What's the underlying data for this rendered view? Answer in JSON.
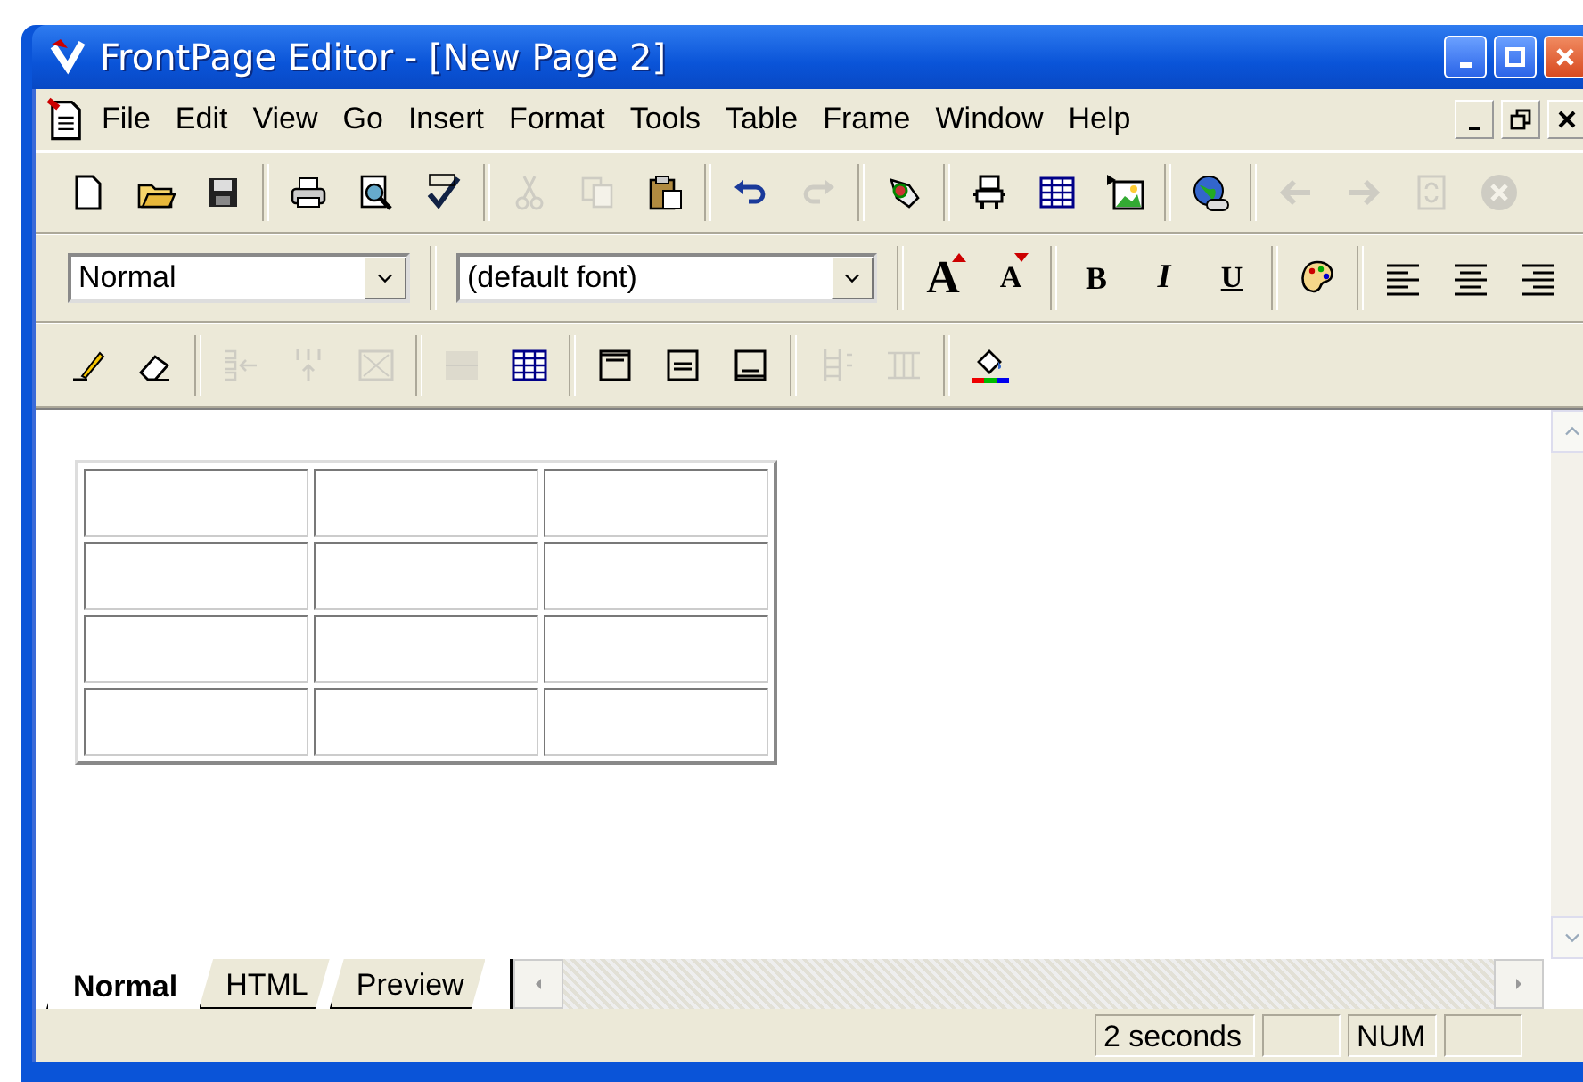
{
  "window": {
    "title": "FrontPage Editor - [New Page 2]"
  },
  "menu": [
    "File",
    "Edit",
    "View",
    "Go",
    "Insert",
    "Format",
    "Tools",
    "Table",
    "Frame",
    "Window",
    "Help"
  ],
  "toolbars": [
    {
      "items": [
        {
          "kind": "button",
          "disabled": false
        },
        {
          "kind": "button",
          "disabled": false
        },
        {
          "kind": "button",
          "disabled": false
        },
        {
          "kind": "separator"
        },
        {
          "kind": "button",
          "disabled": false
        },
        {
          "kind": "button",
          "disabled": false
        },
        {
          "kind": "button",
          "disabled": false
        },
        {
          "kind": "separator"
        },
        {
          "kind": "button",
          "disabled": true
        },
        {
          "kind": "button",
          "disabled": true
        },
        {
          "kind": "button",
          "disabled": false
        },
        {
          "kind": "separator"
        },
        {
          "kind": "button",
          "disabled": false
        },
        {
          "kind": "button",
          "disabled": true
        },
        {
          "kind": "separator"
        },
        {
          "kind": "button",
          "disabled": false
        },
        {
          "kind": "separator"
        },
        {
          "kind": "button",
          "disabled": false
        },
        {
          "kind": "button",
          "disabled": false
        },
        {
          "kind": "button",
          "disabled": false
        },
        {
          "kind": "separator"
        },
        {
          "kind": "button",
          "disabled": false
        },
        {
          "kind": "separator"
        },
        {
          "kind": "button",
          "disabled": true
        },
        {
          "kind": "button",
          "disabled": true
        },
        {
          "kind": "button",
          "disabled": true
        },
        {
          "kind": "button",
          "disabled": true
        }
      ]
    },
    {
      "items": [
        {
          "kind": "combo",
          "value": "Normal"
        },
        {
          "kind": "separator"
        },
        {
          "kind": "combo",
          "value": "(default font)"
        },
        {
          "kind": "separator"
        },
        {
          "kind": "letter",
          "label": "A",
          "disabled": false
        },
        {
          "kind": "letter",
          "label": "A",
          "disabled": false
        },
        {
          "kind": "separator"
        },
        {
          "kind": "letter",
          "label": "B",
          "disabled": false
        },
        {
          "kind": "letter",
          "label": "I",
          "disabled": false
        },
        {
          "kind": "letter",
          "label": "U",
          "disabled": false
        },
        {
          "kind": "separator"
        },
        {
          "kind": "button",
          "disabled": false
        },
        {
          "kind": "separator"
        },
        {
          "kind": "button",
          "disabled": false
        },
        {
          "kind": "button",
          "disabled": false
        },
        {
          "kind": "button",
          "disabled": false
        }
      ]
    },
    {
      "items": [
        {
          "kind": "button",
          "disabled": false
        },
        {
          "kind": "button",
          "disabled": false
        },
        {
          "kind": "separator"
        },
        {
          "kind": "button",
          "disabled": true
        },
        {
          "kind": "button",
          "disabled": true
        },
        {
          "kind": "button",
          "disabled": true
        },
        {
          "kind": "separator"
        },
        {
          "kind": "button",
          "disabled": true
        },
        {
          "kind": "button",
          "disabled": false
        },
        {
          "kind": "separator"
        },
        {
          "kind": "button",
          "disabled": false
        },
        {
          "kind": "button",
          "disabled": false
        },
        {
          "kind": "button",
          "disabled": false
        },
        {
          "kind": "separator"
        },
        {
          "kind": "button",
          "disabled": true
        },
        {
          "kind": "button",
          "disabled": true
        },
        {
          "kind": "separator"
        },
        {
          "kind": "button",
          "disabled": false
        }
      ]
    }
  ],
  "table": {
    "rows": [
      {
        "cells": [
          {},
          {},
          {}
        ]
      },
      {
        "cells": [
          {},
          {},
          {}
        ]
      },
      {
        "cells": [
          {},
          {},
          {}
        ]
      },
      {
        "cells": [
          {},
          {},
          {}
        ]
      }
    ]
  },
  "tabs": [
    {
      "label": "Normal",
      "selected": true
    },
    {
      "label": "HTML",
      "selected": false
    },
    {
      "label": "Preview",
      "selected": false
    }
  ],
  "status_bar": {
    "panes": [
      {
        "kind": "text",
        "text": "2 seconds"
      },
      {
        "kind": "blank"
      },
      {
        "kind": "text",
        "text": "NUM"
      },
      {
        "kind": "blank"
      }
    ]
  }
}
